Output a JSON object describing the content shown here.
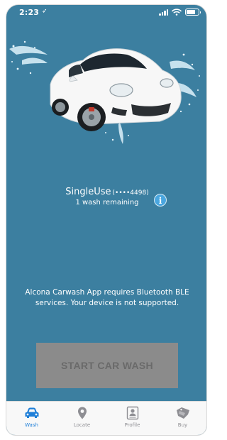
{
  "status_bar": {
    "time": "2:23",
    "location_glyph": "➶"
  },
  "plan": {
    "name": "SingleUse",
    "card_mask": "(••••4498)",
    "remaining": "1 wash remaining",
    "info_glyph": "i"
  },
  "message": "Alcona Carwash App requires Bluetooth BLE services. Your device is not supported.",
  "start_button": {
    "label": "START CAR WASH"
  },
  "tabs": [
    {
      "label": "Wash",
      "icon": "car-icon",
      "active": true
    },
    {
      "label": "Locate",
      "icon": "location-pin-icon",
      "active": false
    },
    {
      "label": "Profile",
      "icon": "profile-card-icon",
      "active": false
    },
    {
      "label": "Buy",
      "icon": "tag-icon",
      "active": false
    }
  ],
  "colors": {
    "background": "#3c7fa0",
    "active_tab": "#1f7fd8",
    "inactive_tab": "#8e8e93",
    "info_badge": "#4aa6df",
    "disabled_button": "#8b8b8b"
  }
}
